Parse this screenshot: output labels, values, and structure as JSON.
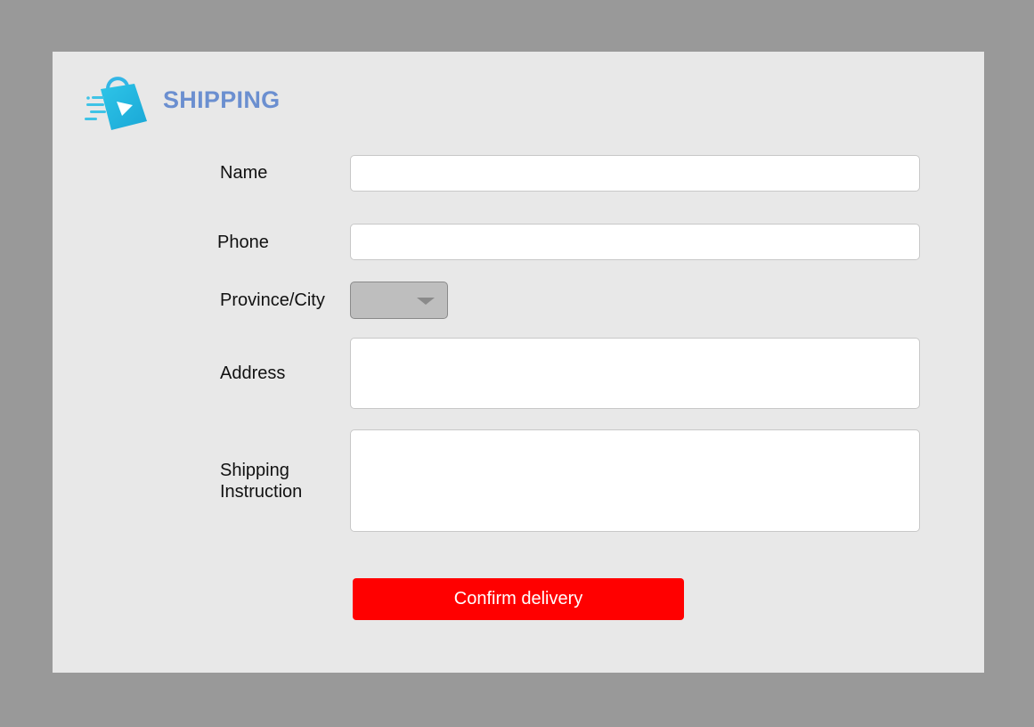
{
  "header": {
    "title": "SHIPPING",
    "logo_icon": "shopping-bag-play-icon"
  },
  "form": {
    "name_label": "Name",
    "name_value": "",
    "phone_label": "Phone",
    "phone_value": "",
    "province_label": "Province/City",
    "province_value": "",
    "address_label": "Address",
    "address_value": "",
    "instruction_label_line1": "Shipping",
    "instruction_label_line2": "Instruction",
    "instruction_value": ""
  },
  "actions": {
    "confirm_label": "Confirm delivery"
  },
  "colors": {
    "background": "#999999",
    "panel": "#e8e8e8",
    "title": "#6b8fd0",
    "button": "#ff0000"
  }
}
